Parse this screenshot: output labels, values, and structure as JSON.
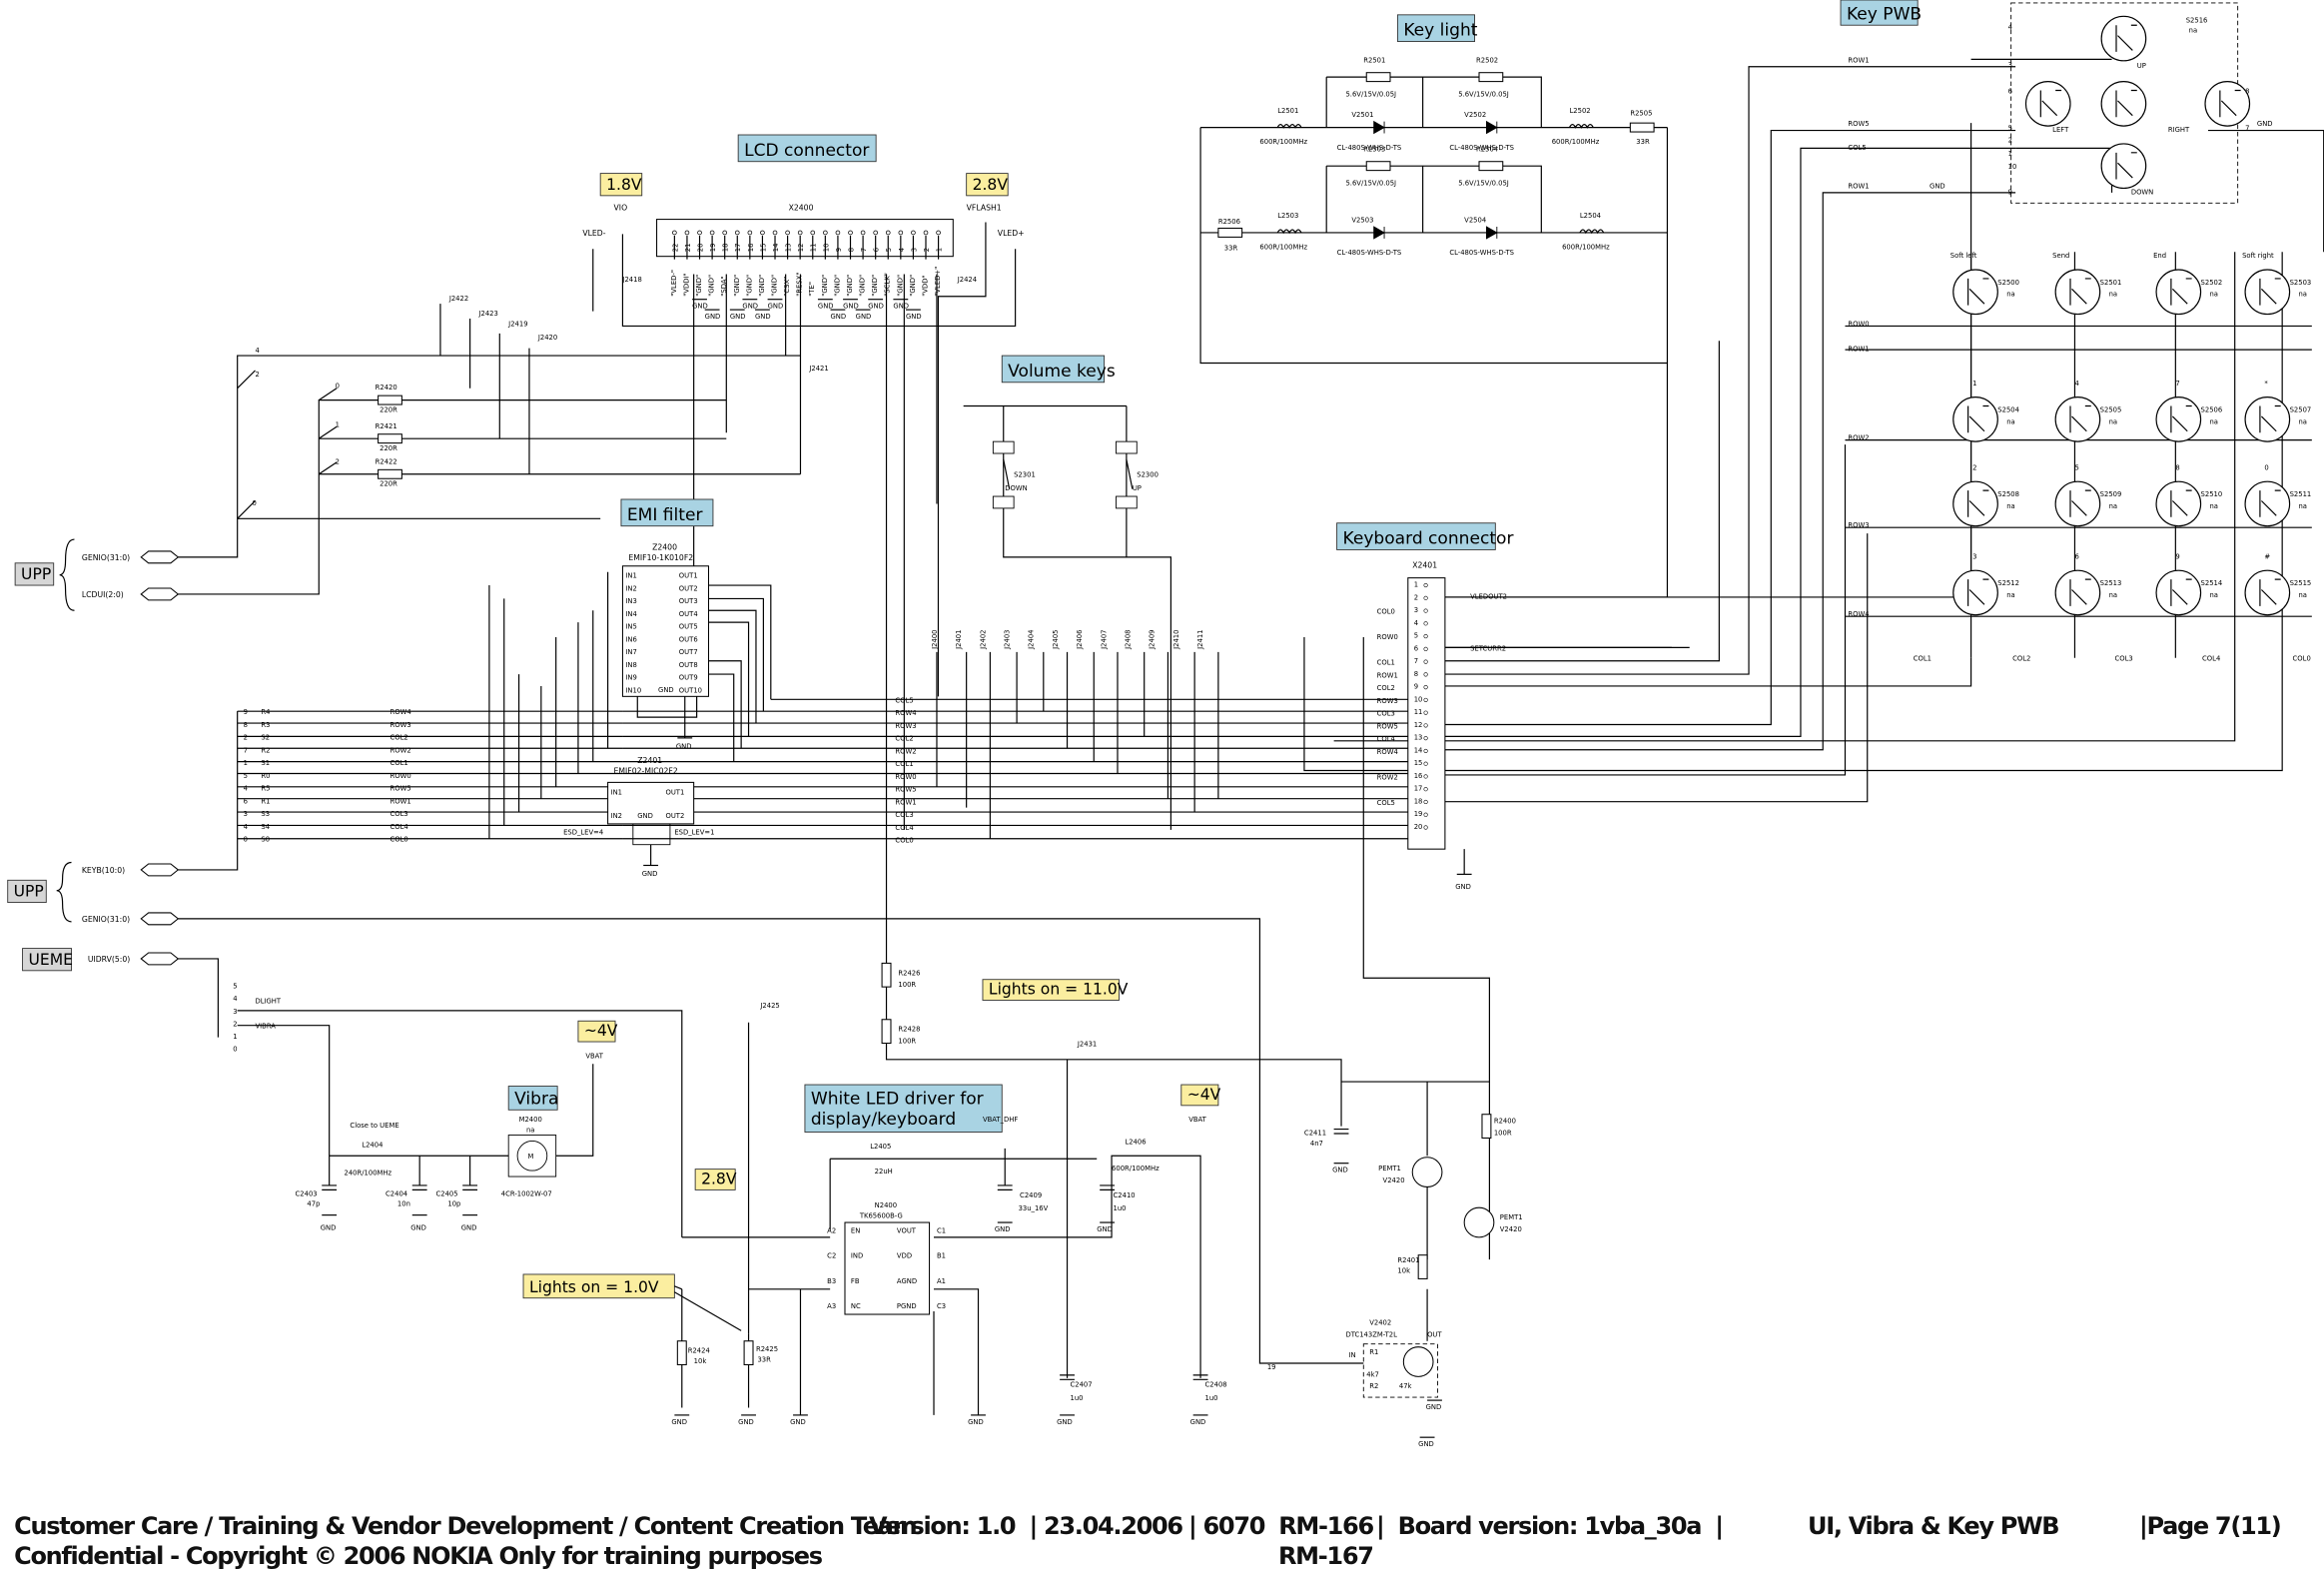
{
  "titles": {
    "key_light": "Key light",
    "key_pwb": "Key PWB",
    "lcd_connector": "LCD connector",
    "volume_keys": "Volume keys",
    "emi_filter": "EMI filter",
    "keyboard_connector": "Keyboard connector",
    "vibra": "Vibra",
    "white_led_line1": "White LED driver for",
    "white_led_line2": "display/keyboard"
  },
  "voltages": {
    "lcd_vio": "1.8V",
    "lcd_vflash": "2.8V",
    "vibra_vbat": "~4V",
    "led_vbat": "~4V",
    "en_2v8": "2.8V",
    "lights_on_11": "Lights on = 11.0V",
    "lights_on_1": "Lights on = 1.0V"
  },
  "side_labels": {
    "upp1": "UPP",
    "upp2": "UPP",
    "ueme": "UEME"
  },
  "buses": {
    "genio_top": "GENIO(31:0)",
    "lcdui": "LCDUI(2:0)",
    "keyb": "KEYB(10:0)",
    "genio_bottom": "GENIO(31:0)",
    "uidrv": "UIDRV(5:0)"
  },
  "lcd": {
    "ref": "X2400",
    "vio": "VIO",
    "vflash": "VFLASH1",
    "vled_minus": "VLED-",
    "vled_plus": "VLED+",
    "j_left": "J2418",
    "j_right": "J2424",
    "gnd": "GND",
    "pins": [
      {
        "n": "22",
        "sig": "\"VLED-\""
      },
      {
        "n": "21",
        "sig": "\"VDDI\""
      },
      {
        "n": "20",
        "sig": "\"GND\""
      },
      {
        "n": "19",
        "sig": "\"GND\""
      },
      {
        "n": "18",
        "sig": "\"SDA\""
      },
      {
        "n": "17",
        "sig": "\"GND\""
      },
      {
        "n": "16",
        "sig": "\"GND\""
      },
      {
        "n": "15",
        "sig": "\"GND\""
      },
      {
        "n": "14",
        "sig": "\"GND\""
      },
      {
        "n": "13",
        "sig": "\"CSX\""
      },
      {
        "n": "12",
        "sig": "\"RESX\""
      },
      {
        "n": "11",
        "sig": "\"TE\""
      },
      {
        "n": "10",
        "sig": "\"GND\""
      },
      {
        "n": "9",
        "sig": "\"GND\""
      },
      {
        "n": "8",
        "sig": "\"GND\""
      },
      {
        "n": "7",
        "sig": "\"GND\""
      },
      {
        "n": "6",
        "sig": "\"GND\""
      },
      {
        "n": "5",
        "sig": "\"SCLK\""
      },
      {
        "n": "4",
        "sig": "\"GND\""
      },
      {
        "n": "3",
        "sig": "\"GND\""
      },
      {
        "n": "2",
        "sig": "\"VDD\""
      },
      {
        "n": "1",
        "sig": "\"VLED+\""
      }
    ]
  },
  "lcdui_net": {
    "j": [
      "J2422",
      "J2423",
      "J2419",
      "J2420",
      "J2421"
    ],
    "pins": [
      "4",
      "2",
      "0",
      "1",
      "2",
      "0"
    ],
    "resistors": [
      {
        "ref": "R2420",
        "val": "220R"
      },
      {
        "ref": "R2421",
        "val": "220R"
      },
      {
        "ref": "R2422",
        "val": "220R"
      }
    ]
  },
  "emi": {
    "z2400": {
      "ref": "Z2400",
      "part": "EMIF10-1K010F2",
      "in": [
        "IN1",
        "IN2",
        "IN3",
        "IN4",
        "IN5",
        "IN6",
        "IN7",
        "IN8",
        "IN9",
        "IN10"
      ],
      "out": [
        "OUT1",
        "OUT2",
        "OUT3",
        "OUT4",
        "OUT5",
        "OUT6",
        "OUT7",
        "OUT8",
        "OUT9",
        "OUT10"
      ],
      "gnd": "GND"
    },
    "z2401": {
      "ref": "Z2401",
      "part": "EMIF02-MIC02F2",
      "in1": "IN1",
      "in2": "IN2",
      "out1": "OUT1",
      "out2": "OUT2",
      "gnd": "GND",
      "esd_left": "ESD_LEV=4",
      "esd_right": "ESD_LEV=1"
    }
  },
  "keyb_bus": [
    {
      "n": "9",
      "r": "R4",
      "net": "ROW4"
    },
    {
      "n": "8",
      "r": "R3",
      "net": "ROW3"
    },
    {
      "n": "2",
      "r": "S2",
      "net": "COL2"
    },
    {
      "n": "7",
      "r": "R2",
      "net": "ROW2"
    },
    {
      "n": "1",
      "r": "S1",
      "net": "COL1"
    },
    {
      "n": "5",
      "r": "R0",
      "net": "ROW0"
    },
    {
      "n": "4",
      "r": "R5",
      "net": "ROW5"
    },
    {
      "n": "6",
      "r": "R1",
      "net": "ROW1"
    },
    {
      "n": "3",
      "r": "S3",
      "net": "COL3"
    },
    {
      "n": "4",
      "r": "S4",
      "net": "COL4"
    },
    {
      "n": "0",
      "r": "S0",
      "net": "COL0"
    }
  ],
  "mid_nets": [
    "COL5",
    "ROW4",
    "ROW3",
    "COL2",
    "ROW2",
    "COL1",
    "ROW0",
    "ROW5",
    "ROW1",
    "COL3",
    "COL4",
    "COL0"
  ],
  "test_points": [
    "J2400",
    "J2401",
    "J2402",
    "J2403",
    "J2404",
    "J2405",
    "J2406",
    "J2407",
    "J2408",
    "J2409",
    "J2410",
    "J2411"
  ],
  "volume": {
    "down_ref": "S2301",
    "down": "DOWN",
    "up_ref": "S2300",
    "up": "UP"
  },
  "keyboard_conn": {
    "ref": "X2401",
    "pins": [
      "1",
      "2",
      "3",
      "4",
      "5",
      "6",
      "7",
      "8",
      "9",
      "10",
      "11",
      "12",
      "13",
      "14",
      "15",
      "16",
      "17",
      "18",
      "19",
      "20"
    ],
    "left": [
      {
        "pin": "3",
        "net": "COL0"
      },
      {
        "pin": "5",
        "net": "ROW0"
      },
      {
        "pin": "7",
        "net": "COL1"
      },
      {
        "pin": "8",
        "net": "ROW1"
      },
      {
        "pin": "9",
        "net": "COL2"
      },
      {
        "pin": "10",
        "net": "ROW3"
      },
      {
        "pin": "11",
        "net": "COL3"
      },
      {
        "pin": "12",
        "net": "ROW5"
      },
      {
        "pin": "13",
        "net": "COL4"
      },
      {
        "pin": "14",
        "net": "ROW4"
      },
      {
        "pin": "16",
        "net": "ROW2"
      },
      {
        "pin": "18",
        "net": "COL5"
      }
    ],
    "vledout2": "VLEDOUT2",
    "setcurr2": "SETCURR2",
    "gnd": "GND"
  },
  "key_light": {
    "resistors": [
      {
        "ref": "R2501",
        "val": "5.6V/15V/0.05J"
      },
      {
        "ref": "R2502",
        "val": "5.6V/15V/0.05J"
      },
      {
        "ref": "R2503",
        "val": "5.6V/15V/0.05J"
      },
      {
        "ref": "R2504",
        "val": "5.6V/15V/0.05J"
      }
    ],
    "leds": [
      {
        "ref": "V2501",
        "part": "CL-480S-WHS-D-TS"
      },
      {
        "ref": "V2502",
        "part": "CL-480S-WHS-D-TS"
      },
      {
        "ref": "V2503",
        "part": "CL-480S-WHS-D-TS"
      },
      {
        "ref": "V2504",
        "part": "CL-480S-WHS-D-TS"
      }
    ],
    "l2501": {
      "ref": "L2501",
      "val": "600R/100MHz"
    },
    "l2502": {
      "ref": "L2502",
      "val": "600R/100MHz"
    },
    "l2503": {
      "ref": "L2503",
      "val": "600R/100MHz"
    },
    "l2504": {
      "ref": "L2504",
      "val": "600R/100MHz"
    },
    "r2505": {
      "ref": "R2505",
      "val": "33R"
    },
    "r2506": {
      "ref": "R2506",
      "val": "33R"
    }
  },
  "key_pwb": {
    "rows": [
      "ROW1",
      "ROW5",
      "COL5",
      "ROW1",
      "ROW0",
      "ROW1",
      "ROW2",
      "ROW3",
      "ROW4"
    ],
    "cols": [
      "COL1",
      "COL2",
      "COL3",
      "COL4",
      "COL0"
    ],
    "nav": {
      "ref": "S2516",
      "val": "na",
      "up": "UP",
      "left": "LEFT",
      "down": "DOWN",
      "right": "RIGHT",
      "gnd": "GND",
      "pins": [
        "4",
        "3",
        "6",
        "5",
        "2",
        "1",
        "10",
        "9",
        "8",
        "7"
      ]
    },
    "keys": [
      {
        "label": "Soft left",
        "ref": "S2500",
        "val": "na"
      },
      {
        "label": "Send",
        "ref": "S2501",
        "val": "na"
      },
      {
        "label": "End",
        "ref": "S2502",
        "val": "na"
      },
      {
        "label": "Soft right",
        "ref": "S2503",
        "val": "na"
      },
      {
        "label": "1",
        "ref": "S2504",
        "val": "na"
      },
      {
        "label": "4",
        "ref": "S2505",
        "val": "na"
      },
      {
        "label": "7",
        "ref": "S2506",
        "val": "na"
      },
      {
        "label": "*",
        "ref": "S2507",
        "val": "na"
      },
      {
        "label": "2",
        "ref": "S2508",
        "val": "na"
      },
      {
        "label": "5",
        "ref": "S2509",
        "val": "na"
      },
      {
        "label": "8",
        "ref": "S2510",
        "val": "na"
      },
      {
        "label": "0",
        "ref": "S2511",
        "val": "na"
      },
      {
        "label": "3",
        "ref": "S2512",
        "val": "na"
      },
      {
        "label": "6",
        "ref": "S2513",
        "val": "na"
      },
      {
        "label": "9",
        "ref": "S2514",
        "val": "na"
      },
      {
        "label": "#",
        "ref": "S2515",
        "val": "na"
      }
    ]
  },
  "uidrv": {
    "pins": [
      "5",
      "4",
      "3",
      "2",
      "1",
      "0"
    ],
    "dlight": "DLIGHT",
    "vibra": "VIBRA"
  },
  "vibra_ckt": {
    "motor_ref": "M2400",
    "motor_val": "na",
    "motor_sym": "M",
    "motor_part": "4CR-1002W-07",
    "vbat": "VBAT",
    "note": "Close to UEME",
    "l2404": "L2404",
    "l2404_val": "240R/100MHz",
    "caps": [
      {
        "ref": "C2403",
        "val": "47p"
      },
      {
        "ref": "C2404",
        "val": "10n"
      },
      {
        "ref": "C2405",
        "val": "10p"
      }
    ],
    "gnd": "GND"
  },
  "led_driver": {
    "ref": "N2400",
    "part": "TK65600B-G",
    "left_pins": [
      {
        "ball": "A2",
        "name": "EN"
      },
      {
        "ball": "C2",
        "name": "IND"
      },
      {
        "ball": "B3",
        "name": "FB"
      },
      {
        "ball": "A3",
        "name": "NC"
      }
    ],
    "right_pins": [
      {
        "ball": "C1",
        "name": "VOUT"
      },
      {
        "ball": "B1",
        "name": "VDD"
      },
      {
        "ball": "A1",
        "name": "AGND"
      },
      {
        "ball": "C3",
        "name": "PGND"
      }
    ],
    "l2405": "L2405",
    "l2405_val": "22uH",
    "vbat_dhf": "VBAT_DHF",
    "c2409": "C2409",
    "c2409_val": "33u_16V",
    "l2406": "L2406",
    "l2406_val": "600R/100MHz",
    "c2410": "C2410",
    "c2410_val": "1u0",
    "c2407": "C2407",
    "c2407_val": "1u0",
    "c2408": "C2408",
    "c2408_val": "1u0",
    "vbat": "VBAT",
    "r2424": "R2424",
    "r2424_val": "10k",
    "r2425": "R2425",
    "r2425_val": "33R",
    "r2426": "R2426",
    "r2426_val": "100R",
    "r2428": "R2428",
    "r2428_val": "100R",
    "j2425": "J2425",
    "j2431": "J2431"
  },
  "transistors": {
    "c2411": "C2411",
    "c2411_val": "4n7",
    "r2400": "R2400",
    "r2400_val": "100R",
    "pemt1_a": "PEMT1",
    "v2420_a": "V2420",
    "pemt1_b": "PEMT1",
    "v2420_b": "V2420",
    "r2401": "R2401",
    "r2401_val": "10k",
    "v2402": "V2402",
    "v2402_part": "DTC143ZM-T2L",
    "r1": "R1",
    "r1_val": "4k7",
    "r2": "R2",
    "r2_val": "47k",
    "in": "IN",
    "out": "OUT",
    "pin19": "19"
  },
  "footer": {
    "line1_left": "Customer Care / Training & Vendor Development / Content Creation Team",
    "version": "Version: 1.0  |",
    "date": "23.04.2006",
    "product": "| 6070  RM-166",
    "board": "|  Board version: 1vba_30a  |",
    "page_title": "UI, Vibra & Key PWB",
    "page": "|Page 7(11)",
    "line2_left": "Confidential - Copyright © 2006 NOKIA Only for training purposes",
    "product2": "RM-167"
  }
}
